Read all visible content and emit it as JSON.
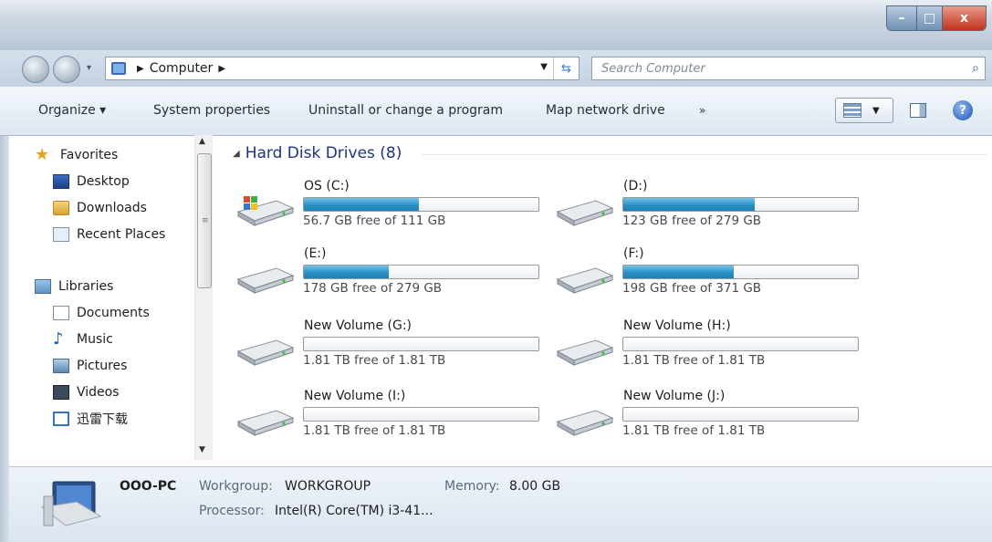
{
  "window": {
    "controls": {
      "minimize": "–",
      "maximize": "□",
      "close": "x"
    }
  },
  "navigation": {
    "back_icon": "back-arrow-icon",
    "forward_icon": "forward-arrow-icon",
    "breadcrumb": [
      "Computer"
    ],
    "search_placeholder": "Search Computer",
    "search_icon": "magnifier-icon"
  },
  "toolbar": {
    "organize_label": "Organize ▾",
    "system_properties_label": "System properties",
    "uninstall_label": "Uninstall or change a program",
    "map_drive_label": "Map network drive",
    "more_label": "»",
    "help_label": "?"
  },
  "sidebar": {
    "favorites": {
      "label": "Favorites",
      "icon": "star-icon"
    },
    "favorite_items": [
      {
        "label": "Desktop",
        "icon": "desktop-icon"
      },
      {
        "label": "Downloads",
        "icon": "downloads-folder-icon"
      },
      {
        "label": "Recent Places",
        "icon": "recent-places-icon"
      }
    ],
    "libraries": {
      "label": "Libraries",
      "icon": "libraries-icon"
    },
    "library_items": [
      {
        "label": "Documents",
        "icon": "documents-icon"
      },
      {
        "label": "Music",
        "icon": "music-icon"
      },
      {
        "label": "Pictures",
        "icon": "pictures-icon"
      },
      {
        "label": "Videos",
        "icon": "videos-icon"
      },
      {
        "label": "迅雷下载",
        "icon": "thunder-download-folder-icon"
      }
    ]
  },
  "content": {
    "group_title": "Hard Disk Drives (8)",
    "drives": [
      {
        "name": "OS  (C:)",
        "size_text": "56.7 GB free of 111 GB",
        "used_fraction": 0.49,
        "icon": "windows-system-drive-icon"
      },
      {
        "name": "(D:)",
        "size_text": "123 GB free of 279 GB",
        "used_fraction": 0.56,
        "icon": "hard-drive-icon"
      },
      {
        "name": "(E:)",
        "size_text": "178 GB free of 279 GB",
        "used_fraction": 0.36,
        "icon": "hard-drive-icon"
      },
      {
        "name": "(F:)",
        "size_text": "198 GB free of 371 GB",
        "used_fraction": 0.47,
        "icon": "hard-drive-icon"
      },
      {
        "name": "New Volume (G:)",
        "size_text": "1.81 TB free of 1.81 TB",
        "used_fraction": 0.0,
        "icon": "hard-drive-icon"
      },
      {
        "name": "New Volume (H:)",
        "size_text": "1.81 TB free of 1.81 TB",
        "used_fraction": 0.0,
        "icon": "hard-drive-icon"
      },
      {
        "name": "New Volume (I:)",
        "size_text": "1.81 TB free of 1.81 TB",
        "used_fraction": 0.0,
        "icon": "hard-drive-icon"
      },
      {
        "name": "New Volume (J:)",
        "size_text": "1.81 TB free of 1.81 TB",
        "used_fraction": 0.0,
        "icon": "hard-drive-icon"
      }
    ]
  },
  "details": {
    "pc_name": "OOO-PC",
    "workgroup_label": "Workgroup:",
    "workgroup_value": "WORKGROUP",
    "memory_label": "Memory:",
    "memory_value": "8.00 GB",
    "processor_label": "Processor:",
    "processor_value": "Intel(R) Core(TM) i3-41..."
  },
  "colors": {
    "accent": "#1e3287",
    "drive_bar_fill": "#2a91c7",
    "close_button": "#c2321a"
  }
}
